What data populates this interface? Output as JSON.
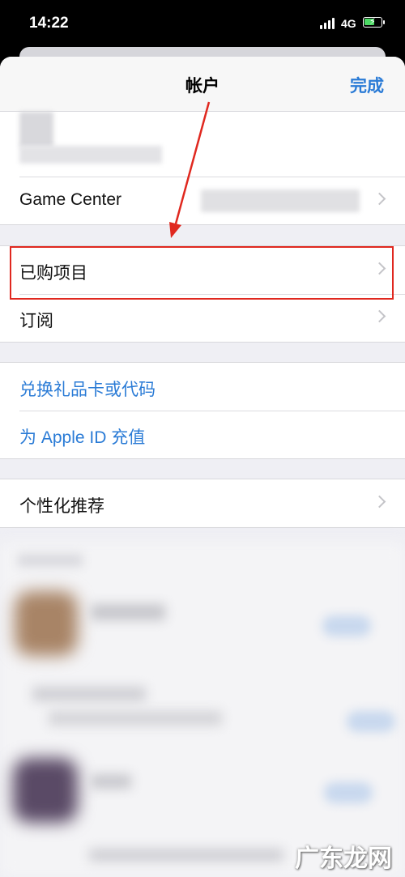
{
  "status_bar": {
    "time": "14:22",
    "network": "4G"
  },
  "nav": {
    "title": "帐户",
    "done_label": "完成"
  },
  "rows": {
    "game_center": "Game Center",
    "purchased": "已购项目",
    "subscriptions": "订阅",
    "redeem": "兑换礼品卡或代码",
    "add_funds": "为 Apple ID 充值",
    "personalized": "个性化推荐"
  },
  "colors": {
    "link": "#2a7bd6",
    "highlight": "#e0281f",
    "battery": "#4cd964"
  },
  "watermark": "广东龙网"
}
